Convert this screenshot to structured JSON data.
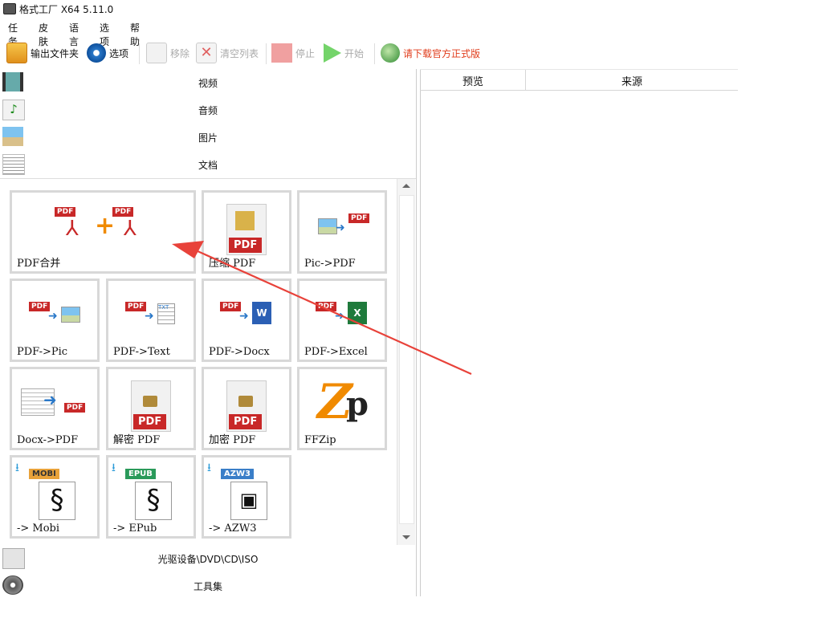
{
  "window": {
    "title": "格式工厂 X64 5.11.0"
  },
  "menu": [
    "任务",
    "皮肤",
    "语言",
    "选项",
    "帮助"
  ],
  "toolbar": {
    "output_folder": "输出文件夹",
    "options": "选项",
    "remove": "移除",
    "clear_list": "清空列表",
    "stop": "停止",
    "start": "开始",
    "download": "请下载官方正式版",
    "download_color": "#e03b1a"
  },
  "categories": {
    "video": "视频",
    "audio": "音频",
    "picture": "图片",
    "document": "文档",
    "disc": "光驱设备\\DVD\\CD\\ISO",
    "tools": "工具集"
  },
  "tiles": {
    "pdf_merge": "PDF合并",
    "compress_pdf": "压缩 PDF",
    "pic_to_pdf": "Pic->PDF",
    "pdf_to_pic": "PDF->Pic",
    "pdf_to_text": "PDF->Text",
    "pdf_to_docx": "PDF->Docx",
    "pdf_to_excel": "PDF->Excel",
    "docx_to_pdf": "Docx->PDF",
    "decrypt_pdf": "解密 PDF",
    "encrypt_pdf": "加密 PDF",
    "ffzip": "FFZip",
    "to_mobi": "-> Mobi",
    "to_epub": "-> EPub",
    "to_azw3": "-> AZW3"
  },
  "icon_text": {
    "pdf": "PDF",
    "txt": "TXT",
    "x": "X",
    "w": "W",
    "mobi": "MOBI",
    "epub": "EPUB",
    "azw3": "AZW3"
  },
  "list_columns": [
    "预览",
    "来源"
  ],
  "annotation": {
    "arrow_color": "#e8423a"
  }
}
